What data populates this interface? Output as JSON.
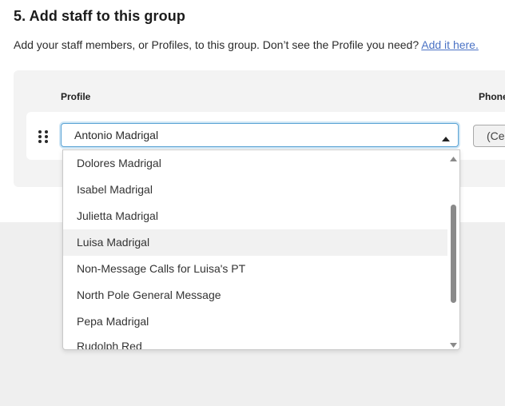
{
  "section": {
    "title": "5. Add staff to this group",
    "description": "Add your staff members, or Profiles, to this group. Don’t see the Profile you need?",
    "add_link": "Add it here."
  },
  "table": {
    "columns": [
      "Profile",
      "Phone"
    ]
  },
  "row": {
    "profile_value": "Antonio Madrigal",
    "phone_value": "(Ce"
  },
  "dropdown": {
    "options": [
      "Dolores Madrigal",
      "Isabel Madrigal",
      "Julietta Madrigal",
      "Luisa Madrigal",
      "Non-Message Calls for Luisa's PT",
      "North Pole General Message",
      "Pepa Madrigal",
      "Rudolph Red"
    ],
    "highlighted_option": "Luisa Madrigal"
  },
  "colors": {
    "link": "#4a72c4",
    "focus_border": "#5aa3d4",
    "highlight_bg": "#f1f1f1"
  }
}
